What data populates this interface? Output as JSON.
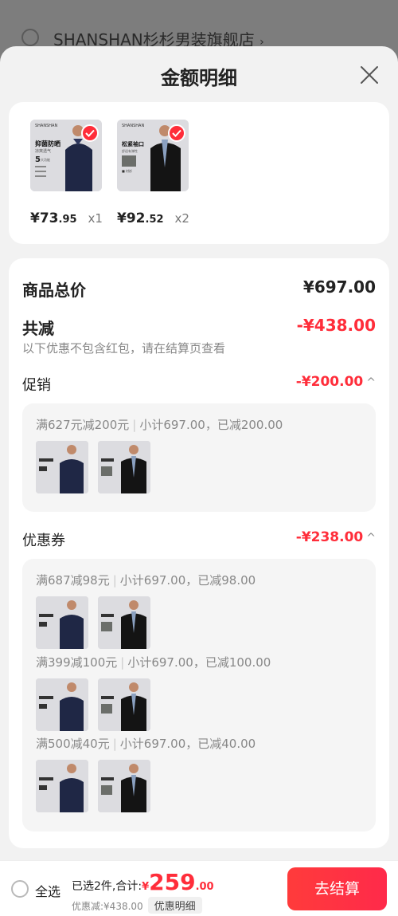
{
  "store": {
    "name": "SHANSHAN杉杉男装旗舰店",
    "chevron": "›"
  },
  "sheet": {
    "title": "金额明细"
  },
  "products": [
    {
      "image_text": [
        "SHANSHAN",
        "抑菌防晒",
        "凉爽透气",
        "5",
        "大功能"
      ],
      "price_int": "¥73",
      "price_dec": ".95",
      "qty": "x1"
    },
    {
      "image_text": [
        "SHANSHAN",
        "松紧袖口",
        "舒适有弹性",
        "■ 衬衫"
      ],
      "price_int": "¥92",
      "price_dec": ".52",
      "qty": "x2"
    }
  ],
  "summary": {
    "total_label": "商品总价",
    "total_value": "¥697.00",
    "reduce_label": "共减",
    "reduce_value": "-¥438.00",
    "note": "以下优惠不包含红包，请在结算页查看"
  },
  "promotion": {
    "label": "促销",
    "value": "-¥200.00",
    "chevron": "^",
    "rules": [
      {
        "rule": "满627元减200元",
        "detail": "小计697.00，已减200.00"
      }
    ]
  },
  "coupon": {
    "label": "优惠券",
    "value": "-¥238.00",
    "chevron": "^",
    "rules": [
      {
        "rule": "满687减98元",
        "detail": "小计697.00，已减98.00"
      },
      {
        "rule": "满399减100元",
        "detail": "小计697.00，已减100.00"
      },
      {
        "rule": "满500减40元",
        "detail": "小计697.00，已减40.00"
      }
    ]
  },
  "bottom": {
    "select_all": "全选",
    "selected": "已选2件,合计:",
    "currency": "¥",
    "amount_int": "259",
    "amount_dec": ".00",
    "discount": "优惠减:¥438.00",
    "detail_btn": "优惠明细",
    "checkout": "去结算"
  },
  "icons": {
    "close": "close-icon",
    "check": "check-icon"
  },
  "colors": {
    "accent": "#ff2d3a",
    "sheet_bg": "#f2f2f2",
    "card_bg": "#ffffff"
  }
}
